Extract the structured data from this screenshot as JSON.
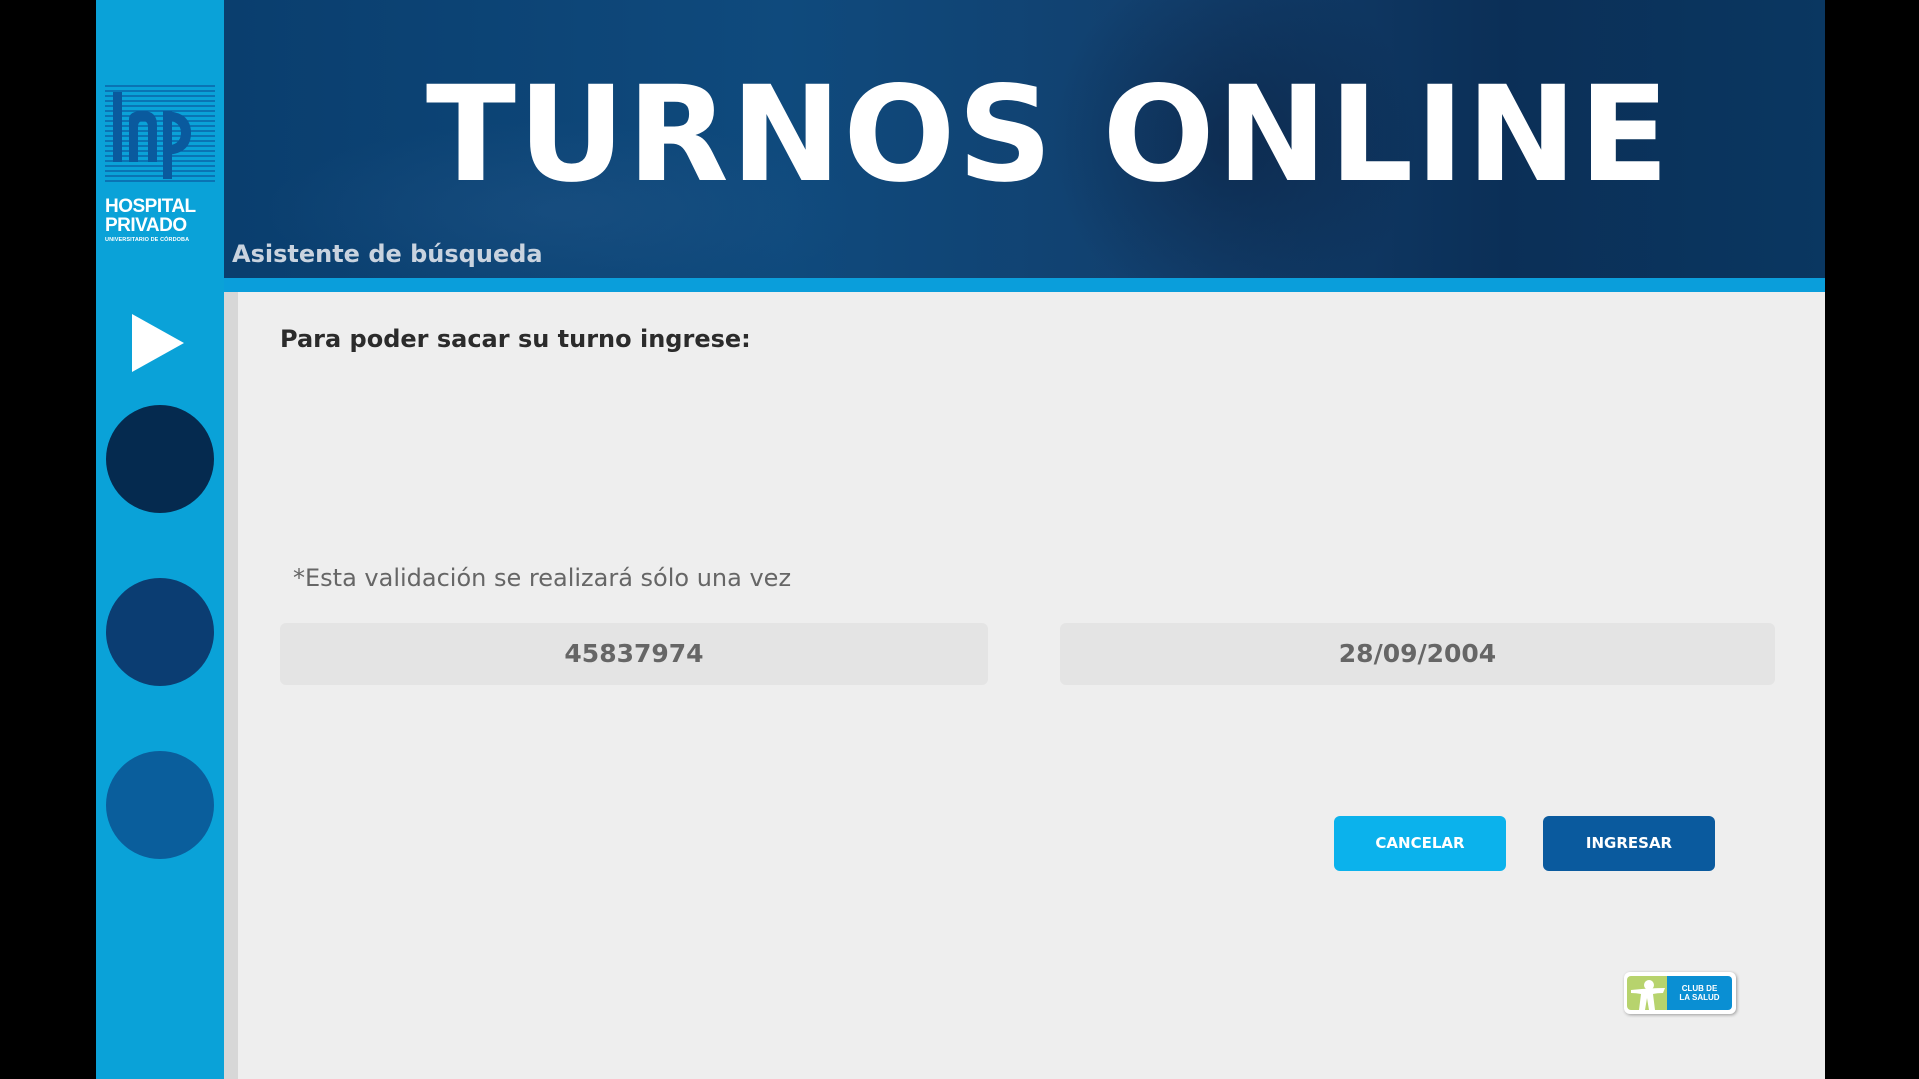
{
  "brand": {
    "logo_line1": "HOSPITAL",
    "logo_line2": "PRIVADO",
    "logo_sub": "UNIVERSITARIO DE CÓRDOBA",
    "colors": {
      "sidebar": "#0aa2d8",
      "header": "#0f4a7d",
      "accent_bar": "#0a9edb",
      "cancel": "#0bb2ec",
      "enter": "#0a5a9e"
    }
  },
  "header": {
    "title": "TURNOS ONLINE",
    "subtitle": "Asistente de búsqueda"
  },
  "sidebar": {
    "play_icon": "play-icon",
    "steps": [
      "step-1",
      "step-2",
      "step-3"
    ]
  },
  "form": {
    "instruction": "Para poder sacar su turno ingrese:",
    "note": "*Esta validación se realizará sólo una vez",
    "dni_value": "45837974",
    "birthdate_value": "28/09/2004"
  },
  "actions": {
    "cancel_label": "CANCELAR",
    "enter_label": "INGRESAR"
  },
  "club_badge": {
    "line1": "CLUB DE",
    "line2": "LA SALUD"
  }
}
